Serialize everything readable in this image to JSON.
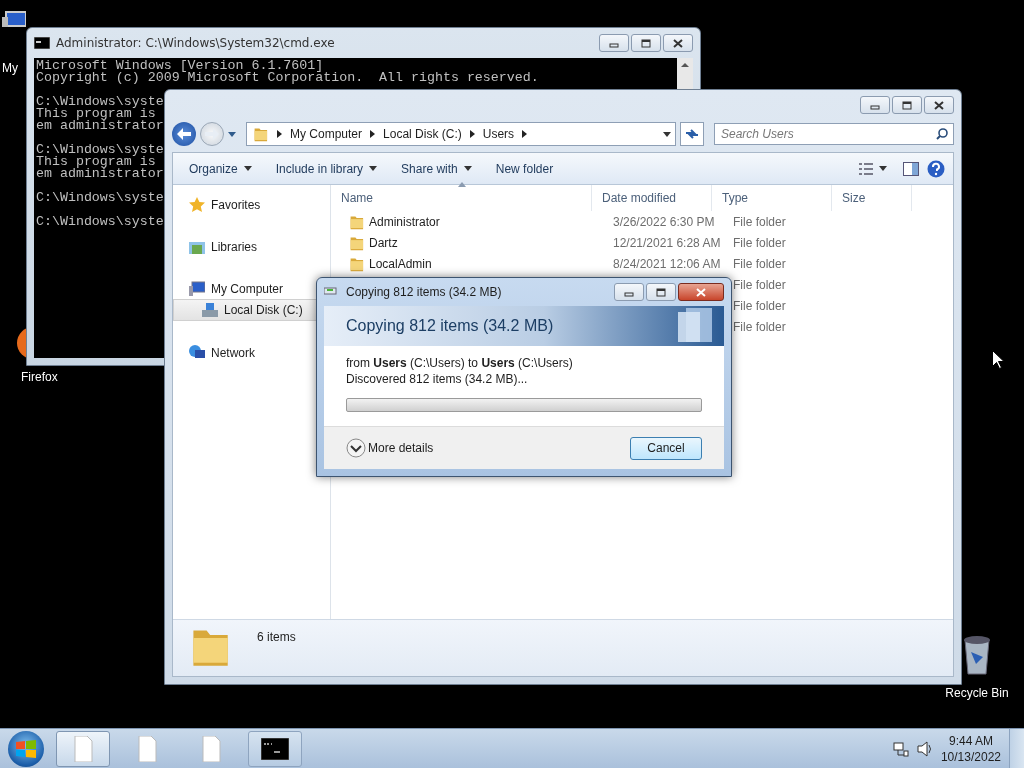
{
  "desktop_icons": [
    {
      "label": "My",
      "kind": "computer"
    },
    {
      "label": "Firefox",
      "kind": "firefox"
    },
    {
      "label": "Recycle Bin",
      "kind": "bin"
    }
  ],
  "cmd_window": {
    "title": "Administrator: C:\\Windows\\System32\\cmd.exe",
    "blocks": [
      [
        "Microsoft Windows [Version 6.1.7601]",
        "Copyright (c) 2009 Microsoft Corporation.  All rights reserved."
      ],
      [
        "C:\\Windows\\syste",
        "This program is",
        "em administrator"
      ],
      [
        "C:\\Windows\\syste",
        "This program is",
        "em administrator"
      ],
      [
        "C:\\Windows\\syste"
      ],
      [
        "C:\\Windows\\syste"
      ]
    ]
  },
  "explorer": {
    "breadcrumb": [
      "My Computer",
      "Local Disk (C:)",
      "Users"
    ],
    "search": {
      "placeholder": "Search Users"
    },
    "toolbar": [
      {
        "label": "Organize",
        "menu": true
      },
      {
        "label": "Include in library",
        "menu": true
      },
      {
        "label": "Share with",
        "menu": true
      },
      {
        "label": "New folder",
        "menu": false
      }
    ],
    "nav": [
      {
        "label": "Favorites",
        "kind": "star",
        "selected": false
      },
      {
        "label": "Libraries",
        "kind": "library",
        "selected": false
      },
      {
        "label": "My Computer",
        "kind": "computer",
        "selected": false,
        "children": [
          {
            "label": "Local Disk (C:)",
            "kind": "disk",
            "selected": true
          }
        ]
      },
      {
        "label": "Network",
        "kind": "network",
        "selected": false
      }
    ],
    "columns": [
      "Name",
      "Date modified",
      "Type",
      "Size"
    ],
    "rows": [
      {
        "name": "Administrator",
        "date": "3/26/2022 6:30 PM",
        "type": "File folder"
      },
      {
        "name": "Dartz",
        "date": "12/21/2021 6:28 AM",
        "type": "File folder"
      },
      {
        "name": "LocalAdmin",
        "date": "8/24/2021 12:06 AM",
        "type": "File folder"
      },
      {
        "type": "File folder"
      },
      {
        "type": "File folder"
      },
      {
        "type": "File folder"
      }
    ],
    "status": "6 items"
  },
  "copy_dialog": {
    "title": "Copying 812 items (34.2 MB)",
    "heading": "Copying 812 items (34.2 MB)",
    "from_line": "from **Users** (C:\\Users) to **Users** (C:\\Users)",
    "progress_text": "Discovered 812 items (34.2 MB)...",
    "level": 0,
    "more_details": "More details",
    "button": "Cancel"
  },
  "taskbar": {
    "items": [
      {
        "kind": "document",
        "selected": true
      },
      {
        "kind": "document",
        "selected": false
      },
      {
        "kind": "document",
        "selected": false
      },
      {
        "kind": "console",
        "selected": false
      }
    ],
    "time": "9:44 AM",
    "date": "10/13/2022"
  }
}
